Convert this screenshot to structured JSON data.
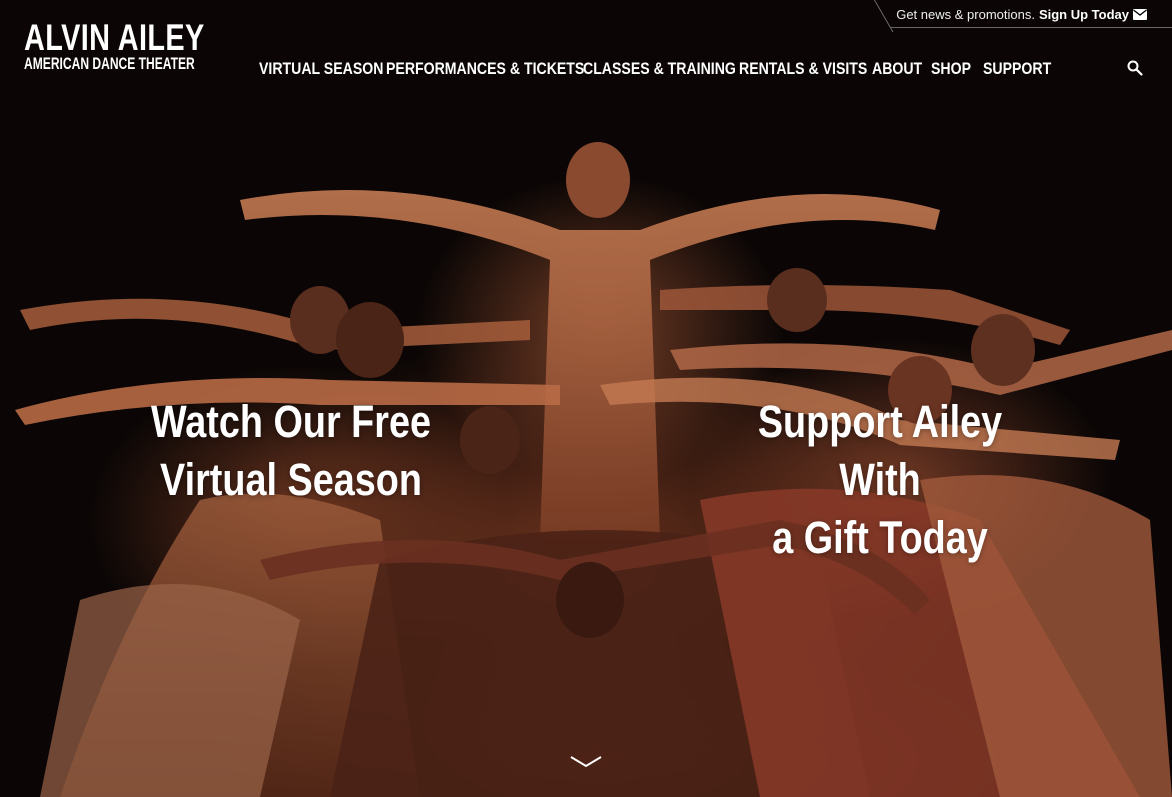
{
  "header": {
    "logo_line1": "ALVIN AILEY",
    "logo_line2": "AMERICAN DANCE THEATER",
    "promo_text": "Get news & promotions.",
    "promo_link": "Sign Up Today",
    "promo_icon": "mail-icon",
    "search_icon": "search-icon"
  },
  "nav": {
    "items": [
      {
        "label": "VIRTUAL SEASON"
      },
      {
        "label": "PERFORMANCES & TICKETS"
      },
      {
        "label": "CLASSES & TRAINING"
      },
      {
        "label": "RENTALS & VISITS"
      },
      {
        "label": "ABOUT"
      },
      {
        "label": "SHOP"
      },
      {
        "label": "SUPPORT"
      }
    ]
  },
  "hero": {
    "left_cta": {
      "line1": "Watch Our Free",
      "line2": "Virtual Season"
    },
    "right_cta": {
      "line1": "Support Ailey With",
      "line2": "a Gift Today"
    },
    "scroll_icon": "chevron-down-icon",
    "colors": {
      "background": "#000000",
      "text": "#ffffff",
      "skin": "#b86a45"
    }
  }
}
